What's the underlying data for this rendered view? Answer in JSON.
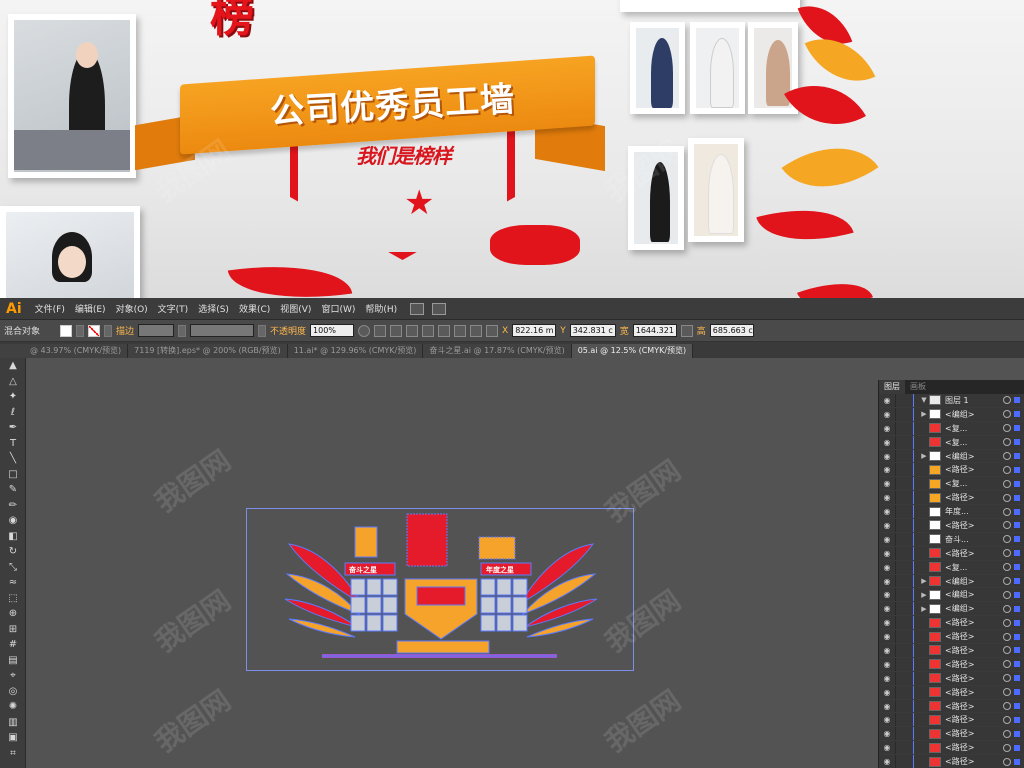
{
  "promo": {
    "banner_top": "榜",
    "ribbon_text": "公司优秀员工墙",
    "slogan": "我们是榜样"
  },
  "app": {
    "logo": "Ai",
    "menu": [
      "文件(F)",
      "编辑(E)",
      "对象(O)",
      "文字(T)",
      "选择(S)",
      "效果(C)",
      "视图(V)",
      "窗口(W)",
      "帮助(H)"
    ]
  },
  "control": {
    "selection": "混合对象",
    "stroke_label": "描边",
    "opacity_label": "不透明度",
    "opacity": "100%",
    "x_label": "X",
    "x": "822.16 m",
    "y_label": "Y",
    "y": "342.831 c",
    "w_label": "宽",
    "w": "1644.321",
    "h_label": "高",
    "h": "685.663 c"
  },
  "tabs": [
    "@ 43.97% (CMYK/预览)",
    "7119 [转换].eps* @ 200% (RGB/预览)",
    "11.ai* @ 129.96% (CMYK/预览)",
    "奋斗之星.ai @ 17.87% (CMYK/预览)",
    "05.ai @ 12.5% (CMYK/预览)"
  ],
  "artwork": {
    "left_title": "奋斗之星",
    "right_title": "年度之星"
  },
  "layers_panel": {
    "tabs": [
      "图层",
      "画板"
    ],
    "rows": [
      {
        "name": "图层 1",
        "arrow": "▼",
        "thumb": "#e8e8e8"
      },
      {
        "name": "<编组>",
        "arrow": "▶",
        "thumb": "#fff"
      },
      {
        "name": "<复...",
        "arrow": "",
        "thumb": "#e33"
      },
      {
        "name": "<复...",
        "arrow": "",
        "thumb": "#e33"
      },
      {
        "name": "<编组>",
        "arrow": "▶",
        "thumb": "#fff"
      },
      {
        "name": "<路径>",
        "arrow": "",
        "thumb": "#f5a623"
      },
      {
        "name": "<复...",
        "arrow": "",
        "thumb": "#f5a623"
      },
      {
        "name": "<路径>",
        "arrow": "",
        "thumb": "#f5a623"
      },
      {
        "name": "年度...",
        "arrow": "",
        "thumb": "#fff"
      },
      {
        "name": "<路径>",
        "arrow": "",
        "thumb": "#fff"
      },
      {
        "name": "奋斗...",
        "arrow": "",
        "thumb": "#fff"
      },
      {
        "name": "<路径>",
        "arrow": "",
        "thumb": "#e33"
      },
      {
        "name": "<复...",
        "arrow": "",
        "thumb": "#e33"
      },
      {
        "name": "<编组>",
        "arrow": "▶",
        "thumb": "#e33"
      },
      {
        "name": "<编组>",
        "arrow": "▶",
        "thumb": "#fff"
      },
      {
        "name": "<编组>",
        "arrow": "▶",
        "thumb": "#fff"
      },
      {
        "name": "<路径>",
        "arrow": "",
        "thumb": "#e33"
      },
      {
        "name": "<路径>",
        "arrow": "",
        "thumb": "#e33"
      },
      {
        "name": "<路径>",
        "arrow": "",
        "thumb": "#e33"
      },
      {
        "name": "<路径>",
        "arrow": "",
        "thumb": "#e33"
      },
      {
        "name": "<路径>",
        "arrow": "",
        "thumb": "#e33"
      },
      {
        "name": "<路径>",
        "arrow": "",
        "thumb": "#e33"
      },
      {
        "name": "<路径>",
        "arrow": "",
        "thumb": "#e33"
      },
      {
        "name": "<路径>",
        "arrow": "",
        "thumb": "#e33"
      },
      {
        "name": "<路径>",
        "arrow": "",
        "thumb": "#e33"
      },
      {
        "name": "<路径>",
        "arrow": "",
        "thumb": "#e33"
      },
      {
        "name": "<路径>",
        "arrow": "",
        "thumb": "#e33"
      }
    ]
  },
  "watermark": "我图网",
  "colors": {
    "accent": "#ff9a00",
    "red": "#e1141c",
    "orange": "#f5a623",
    "selection": "#4d6bff"
  }
}
